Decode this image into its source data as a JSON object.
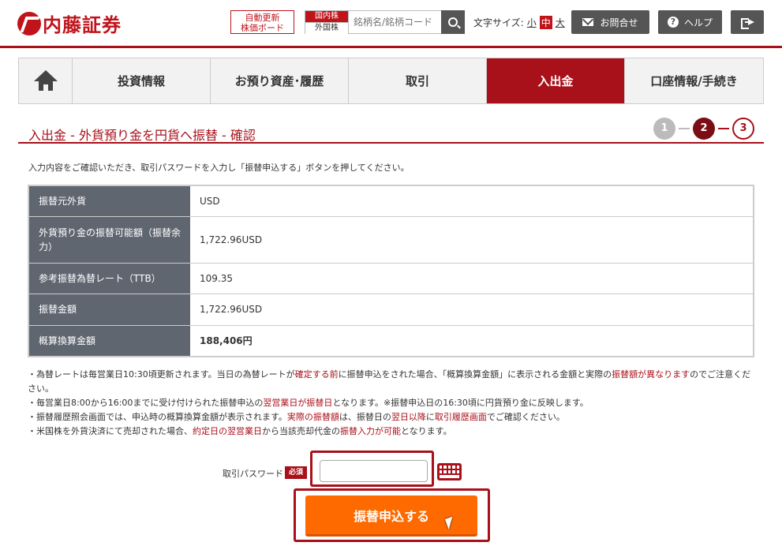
{
  "header": {
    "logo_text": "内藤証券",
    "board_btn_line1": "自動更新",
    "board_btn_line2": "株価ボード",
    "market_domestic": "国内株",
    "market_foreign": "外国株",
    "search_placeholder": "銘柄名/銘柄コード",
    "fontsize_label": "文字サイズ:",
    "fontsize_small": "小",
    "fontsize_mid": "中",
    "fontsize_large": "大",
    "contact_label": "お問合せ",
    "help_label": "ヘルプ"
  },
  "nav": {
    "items": [
      {
        "label": "投資情報"
      },
      {
        "label": "お預り資産･履歴"
      },
      {
        "label": "取引"
      },
      {
        "label": "入出金"
      },
      {
        "label": "口座情報/手続き"
      }
    ]
  },
  "page": {
    "title": "入出金 - 外貨預り金を円貨へ振替 - 確認",
    "steps": [
      "1",
      "2",
      "3"
    ],
    "instruction": "入力内容をご確認いただき、取引パスワードを入力し「振替申込する」ボタンを押してください。"
  },
  "table": {
    "rows": [
      {
        "label": "振替元外貨",
        "value": "USD"
      },
      {
        "label": "外貨預り金の振替可能額（振替余力）",
        "value": "1,722.96USD"
      },
      {
        "label": "参考振替為替レート（TTB）",
        "value": "109.35"
      },
      {
        "label": "振替金額",
        "value": "1,722.96USD"
      },
      {
        "label": "概算換算金額",
        "value": "188,406円"
      }
    ]
  },
  "notes": {
    "n1_a": "・為替レートは毎営業日10:30頃更新されます。当日の為替レートが",
    "n1_b": "確定する前",
    "n1_c": "に振替申込をされた場合、「概算換算金額」に表示される金額と実際の",
    "n1_d": "振替額が異なります",
    "n1_e": "のでご注意ください。",
    "n2_a": "・毎営業日8:00から16:00までに受け付けられた振替申込の",
    "n2_b": "翌営業日が振替日",
    "n2_c": "となります。※振替申込日の16:30頃に円貨預り金に反映します。",
    "n3_a": "・振替履歴照会画面では、申込時の概算換算金額が表示されます。",
    "n3_b": "実際の振替額",
    "n3_c": "は、振替日の",
    "n3_d": "翌日以降",
    "n3_e": "に",
    "n3_f": "取引履歴画面",
    "n3_g": "でご確認ください。",
    "n4_a": "・米国株を外貨決済にて売却された場合、",
    "n4_b": "約定日の翌営業日",
    "n4_c": "から当該売却代金の",
    "n4_d": "振替入力が可能",
    "n4_e": "となります。"
  },
  "form": {
    "password_label": "取引パスワード",
    "required_badge": "必須",
    "password_value": "",
    "submit_label": "振替申込する"
  }
}
